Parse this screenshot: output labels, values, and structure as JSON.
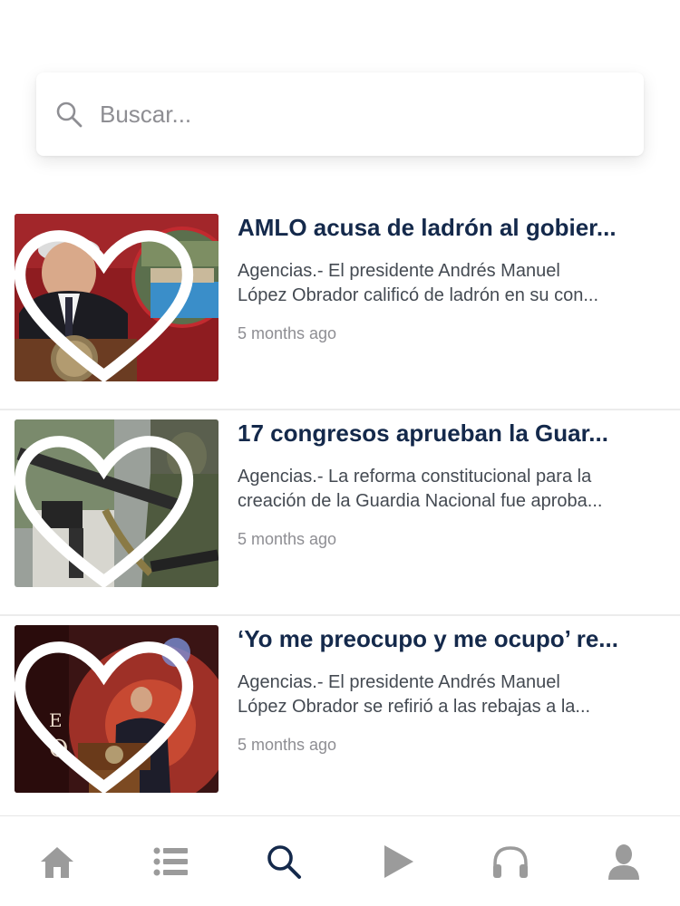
{
  "search": {
    "placeholder": "Buscar..."
  },
  "articles": [
    {
      "title": "AMLO acusa de ladrón al gobier...",
      "excerpt_line1": "Agencias.- El presidente Andrés Manuel",
      "excerpt_line2": "López Obrador calificó de ladrón en su con...",
      "time": "5 months ago"
    },
    {
      "title": "17 congresos aprueban la Guar...",
      "excerpt_line1": "Agencias.- La reforma constitucional para la",
      "excerpt_line2": "creación de la Guardia Nacional fue aproba...",
      "time": "5 months ago"
    },
    {
      "title": "‘Yo me preocupo y me ocupo’ re...",
      "excerpt_line1": "Agencias.- El presidente Andrés Manuel",
      "excerpt_line2": "López Obrador se refirió a las rebajas a la...",
      "time": "5 months ago"
    }
  ],
  "tabs": [
    {
      "icon": "home-icon",
      "active": false
    },
    {
      "icon": "list-icon",
      "active": false
    },
    {
      "icon": "search-icon",
      "active": true
    },
    {
      "icon": "play-icon",
      "active": false
    },
    {
      "icon": "headphones-icon",
      "active": false
    },
    {
      "icon": "user-icon",
      "active": false
    }
  ],
  "colors": {
    "title": "#14294b",
    "active_tab": "#14294b",
    "inactive_tab": "#9b9b9b",
    "muted_text": "#8e8e93"
  }
}
